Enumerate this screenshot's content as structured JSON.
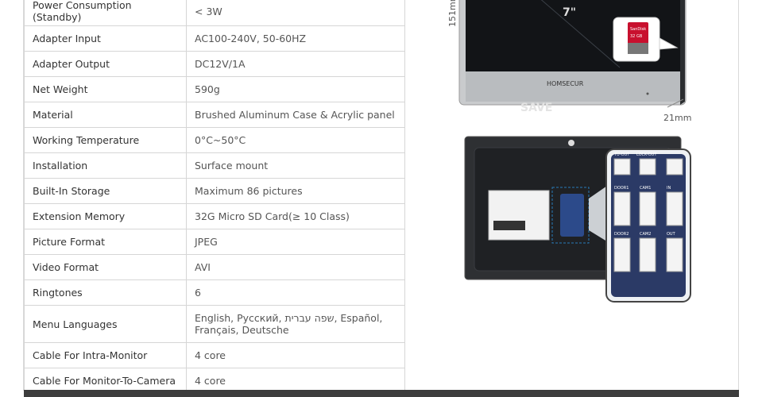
{
  "specs": [
    {
      "label": "Power Consumption (Standby)",
      "value": "< 3W"
    },
    {
      "label": "Adapter Input",
      "value": "AC100-240V, 50-60HZ"
    },
    {
      "label": "Adapter Output",
      "value": "DC12V/1A"
    },
    {
      "label": "Net Weight",
      "value": "590g"
    },
    {
      "label": "Material",
      "value": "Brushed Aluminum Case & Acrylic panel"
    },
    {
      "label": "Working Temperature",
      "value": "0°C~50°C"
    },
    {
      "label": "Installation",
      "value": "Surface mount"
    },
    {
      "label": "Built-In Storage",
      "value": "Maximum 86 pictures"
    },
    {
      "label": "Extension Memory",
      "value": "32G Micro SD Card(≥ 10 Class)"
    },
    {
      "label": "Picture Format",
      "value": "JPEG"
    },
    {
      "label": "Video Format",
      "value": "AVI"
    },
    {
      "label": "Ringtones",
      "value": "6"
    },
    {
      "label": "Menu Languages",
      "value": "English, Русский, שפה עברית, Español, Français, Deutsche"
    },
    {
      "label": "Cable For Intra-Monitor",
      "value": "4 core"
    },
    {
      "label": "Cable For Monitor-To-Camera",
      "value": "4 core"
    }
  ],
  "product": {
    "screen_size": "7\"",
    "height_dim": "151mm",
    "depth_dim": "21mm",
    "brand": "HOMSECUR",
    "sd_brand": "SanDisk",
    "sd_size": "32 GB",
    "watermark": "SAVE"
  },
  "ports": {
    "labels": [
      "TU-OUT",
      "LOCK-OUT",
      "DOOR1",
      "CAM1",
      "IN",
      "DOOR2",
      "CAM2",
      "OUT"
    ]
  }
}
